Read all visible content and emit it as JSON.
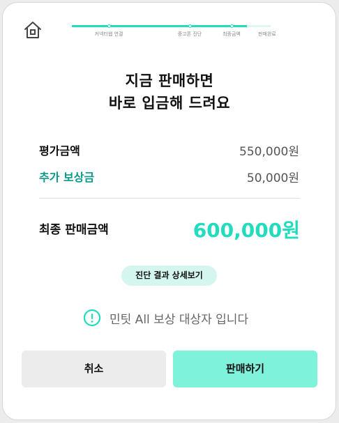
{
  "progress": {
    "value": 0.88,
    "steps": [
      "커넥터웹 연결",
      "중고폰 진단",
      "최종금액",
      "판매완료"
    ]
  },
  "headline": {
    "line1": "지금 판매하면",
    "line2": "바로 입금해 드려요"
  },
  "price": {
    "evaluation_label": "평가금액",
    "evaluation_value": "550,000원",
    "bonus_label": "추가 보상금",
    "bonus_value": "50,000원",
    "final_label": "최종 판매금액",
    "final_value": "600,000원"
  },
  "detail_button_label": "진단 결과 상세보기",
  "notice_text": "민팃 All 보상 대상자 입니다",
  "buttons": {
    "cancel": "취소",
    "sell": "판매하기"
  },
  "colors": {
    "accent": "#23dcbd",
    "bonus_text": "#0a9a87",
    "sell_button": "#7ff2dc",
    "detail_button": "#d4f6ef"
  },
  "icons": {
    "home": "home-icon",
    "notice": "exclamation-circle-icon"
  }
}
